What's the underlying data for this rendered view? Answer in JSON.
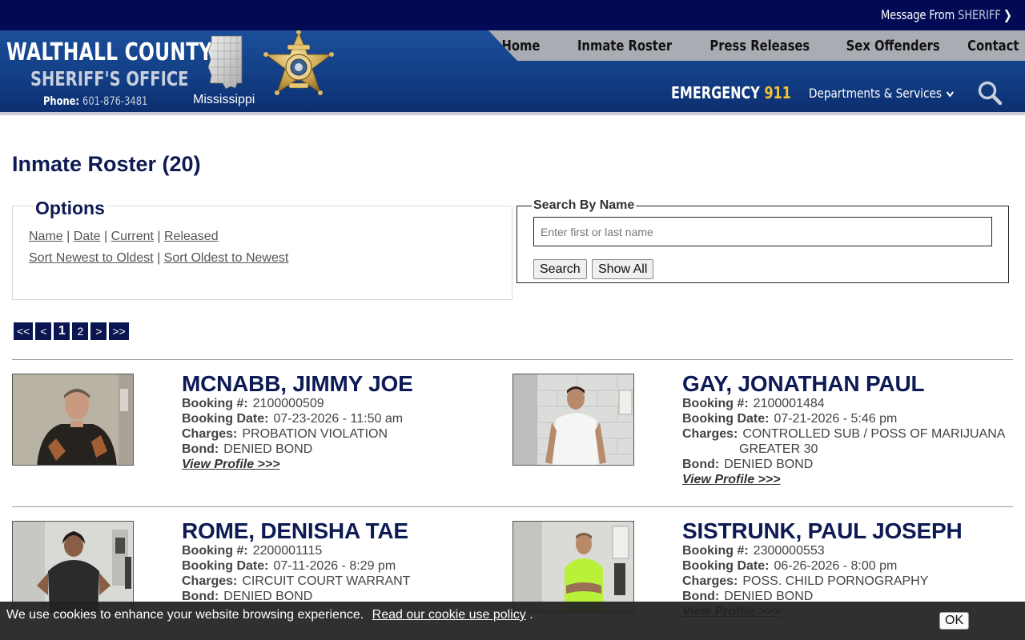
{
  "topbar": {
    "msg_prefix": "Message From",
    "msg_highlight": "SHERIFF"
  },
  "header": {
    "county": "WALTHALL COUNTY",
    "office": "SHERIFF'S OFFICE",
    "phone_label": "Phone:",
    "phone_number": "601-876-3481",
    "state": "Mississippi",
    "emergency_label": "EMERGENCY",
    "emergency_number": "911",
    "departments": "Departments & Services"
  },
  "nav": [
    "Home",
    "Inmate Roster",
    "Press Releases",
    "Sex Offenders",
    "Contact"
  ],
  "page": {
    "title": "Inmate Roster (20)"
  },
  "options": {
    "legend": "Options",
    "sort_links": [
      "Name",
      "Date",
      "Current",
      "Released"
    ],
    "order_links": [
      "Sort Newest to Oldest",
      "Sort Oldest to Newest"
    ]
  },
  "search": {
    "legend": "Search By Name",
    "placeholder": "Enter first or last name",
    "search_button": "Search",
    "show_all_button": "Show All"
  },
  "pager": [
    "<<",
    "<",
    "1",
    "2",
    ">",
    ">>"
  ],
  "labels": {
    "booking_num": "Booking #:",
    "booking_date": "Booking Date:",
    "charges": "Charges:",
    "bond": "Bond:",
    "view_profile": "View Profile >>>"
  },
  "inmates": [
    {
      "name": "MCNABB, JIMMY JOE",
      "booking_num": "2100000509",
      "booking_date": "07-23-2026 - 11:50 am",
      "charges": "PROBATION VIOLATION",
      "charges_cont": "",
      "bond": "DENIED BOND"
    },
    {
      "name": "GAY, JONATHAN PAUL",
      "booking_num": "2100001484",
      "booking_date": "07-21-2026 - 5:46 pm",
      "charges": "CONTROLLED SUB / POSS OF MARIJUANA",
      "charges_cont": "GREATER 30",
      "bond": "DENIED BOND"
    },
    {
      "name": "ROME, DENISHA TAE",
      "booking_num": "2200001115",
      "booking_date": "07-11-2026 - 8:29 pm",
      "charges": "CIRCUIT COURT WARRANT",
      "charges_cont": "",
      "bond": "DENIED BOND"
    },
    {
      "name": "SISTRUNK, PAUL JOSEPH",
      "booking_num": "2300000553",
      "booking_date": "06-26-2026 - 8:00 pm",
      "charges": "POSS. CHILD PORNOGRAPHY",
      "charges_cont": "",
      "bond": "DENIED BOND"
    }
  ],
  "cookie": {
    "text": "We use cookies to enhance your website browsing experience.",
    "link": "Read our cookie use policy",
    "suffix": ".",
    "ok": "OK"
  },
  "colors": {
    "navy": "#020a55",
    "header_blue": "#133f86",
    "title_navy": "#0d1a54",
    "emergency_gold": "#f2c230"
  }
}
